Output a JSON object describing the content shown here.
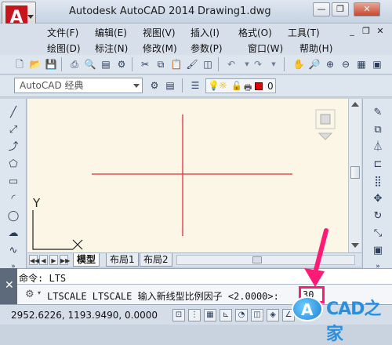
{
  "title_bar": {
    "app_title": "Autodesk AutoCAD 2014",
    "document_title": "Drawing1.dwg",
    "logo_letter": "A"
  },
  "menu_row1": [
    "文件(F)",
    "编辑(E)",
    "视图(V)",
    "插入(I)",
    "格式(O)",
    "工具(T)"
  ],
  "menu_row2": [
    "绘图(D)",
    "标注(N)",
    "修改(M)",
    "参数(P)",
    "窗口(W)",
    "帮助(H)"
  ],
  "workspace_combo": {
    "value": "AutoCAD 经典"
  },
  "layer": {
    "value": "0",
    "color": "#e00000"
  },
  "canvas": {
    "background": "#fbf6e6",
    "crosshair_color": "#e0303a",
    "ucs_y_label": "Y",
    "ucs_x_label": "X"
  },
  "layout_tabs": [
    "模型",
    "布局1",
    "布局2"
  ],
  "command": {
    "history_label": "命令:",
    "history_value": "LTS",
    "prompt": "LTSCALE LTSCALE 输入新线型比例因子 <2.0000>:",
    "value": "30",
    "highlight_color": "#ff1a75"
  },
  "status": {
    "coordinates": "2952.6226, 1193.9490, 0.0000"
  },
  "watermark": {
    "text": "CAD之家",
    "logo_letter": "A"
  }
}
